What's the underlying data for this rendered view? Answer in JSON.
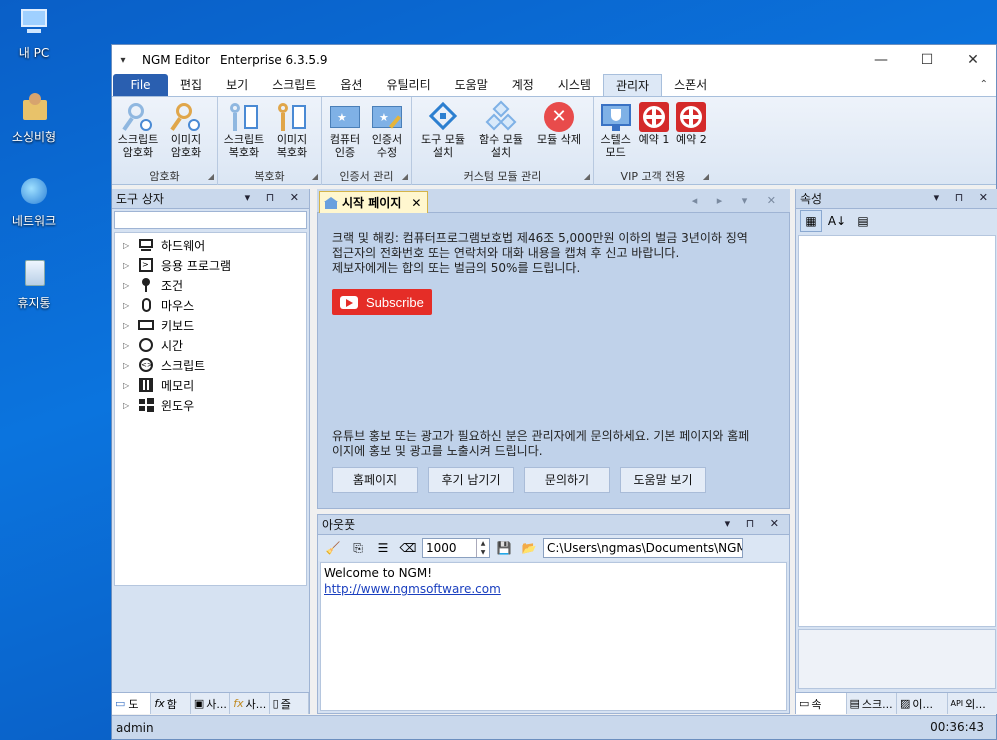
{
  "desktop": {
    "icons": [
      {
        "label": "내 PC",
        "icon": "computer-icon"
      },
      {
        "label": "소싱비형",
        "icon": "user-folder-icon"
      },
      {
        "label": "네트워크",
        "icon": "network-icon"
      },
      {
        "label": "휴지통",
        "icon": "recycle-bin-icon"
      }
    ]
  },
  "window": {
    "app_name": "NGM Editor",
    "edition": "Enterprise 6.3.5.9",
    "controls": {
      "minimize": "—",
      "maximize": "☐",
      "close": "✕"
    }
  },
  "ribbon": {
    "tabs": [
      "File",
      "편집",
      "보기",
      "스크립트",
      "옵션",
      "유틸리티",
      "도움말",
      "계정",
      "시스템",
      "관리자",
      "스폰서"
    ],
    "active_tab": "관리자",
    "groups": [
      {
        "name": "암호화",
        "buttons": [
          "스크립트\n암호화",
          "이미지\n암호화"
        ]
      },
      {
        "name": "복호화",
        "buttons": [
          "스크립트\n복호화",
          "이미지\n복호화"
        ]
      },
      {
        "name": "인증서 관리",
        "buttons": [
          "컴퓨터\n인증",
          "인증서\n수정"
        ]
      },
      {
        "name": "커스텀 모듈 관리",
        "buttons": [
          "도구 모듈\n설치",
          "함수 모듈\n설치",
          "모듈 삭제"
        ]
      },
      {
        "name": "VIP 고객 전용",
        "buttons": [
          "스텔스\n모드",
          "예약 1",
          "예약 2"
        ]
      }
    ]
  },
  "toolbox": {
    "title": "도구 상자",
    "items": [
      "하드웨어",
      "응용 프로그램",
      "조건",
      "마우스",
      "키보드",
      "시간",
      "스크립트",
      "메모리",
      "윈도우"
    ],
    "bottom_tabs": [
      "도",
      "함",
      "사...",
      "사...",
      "즐"
    ]
  },
  "start_page": {
    "tab_label": "시작 페이지",
    "notice_line1": "크랙 및 해킹: 컴퓨터프로그램보호법 제46조 5,000만원 이하의 벌금 3년이하 징역",
    "notice_line2": "접근자의 전화번호 또는 연락처와 대화 내용을 캡쳐 후 신고 바랍니다.",
    "notice_line3": "제보자에게는 합의 또는 벌금의 50%를 드립니다.",
    "subscribe_label": "Subscribe",
    "promo_line1": "유튜브 홍보 또는 광고가 필요하신 분은 관리자에게 문의하세요. 기본 페이지와 홈페",
    "promo_line2": "이지에 홍보 및 광고를 노출시켜 드립니다.",
    "buttons": [
      "홈페이지",
      "후기 남기기",
      "문의하기",
      "도움말 보기"
    ]
  },
  "output": {
    "title": "아웃풋",
    "limit_value": "1000",
    "path_value": "C:\\Users\\ngmas\\Documents\\NGM6\\",
    "lines": [
      "Welcome to NGM!",
      "http://www.ngmsoftware.com"
    ]
  },
  "properties": {
    "title": "속성",
    "bottom_tabs": [
      "속",
      "스크...",
      "이...",
      "외..."
    ]
  },
  "status": {
    "user": "admin",
    "time": "00:36:43"
  }
}
